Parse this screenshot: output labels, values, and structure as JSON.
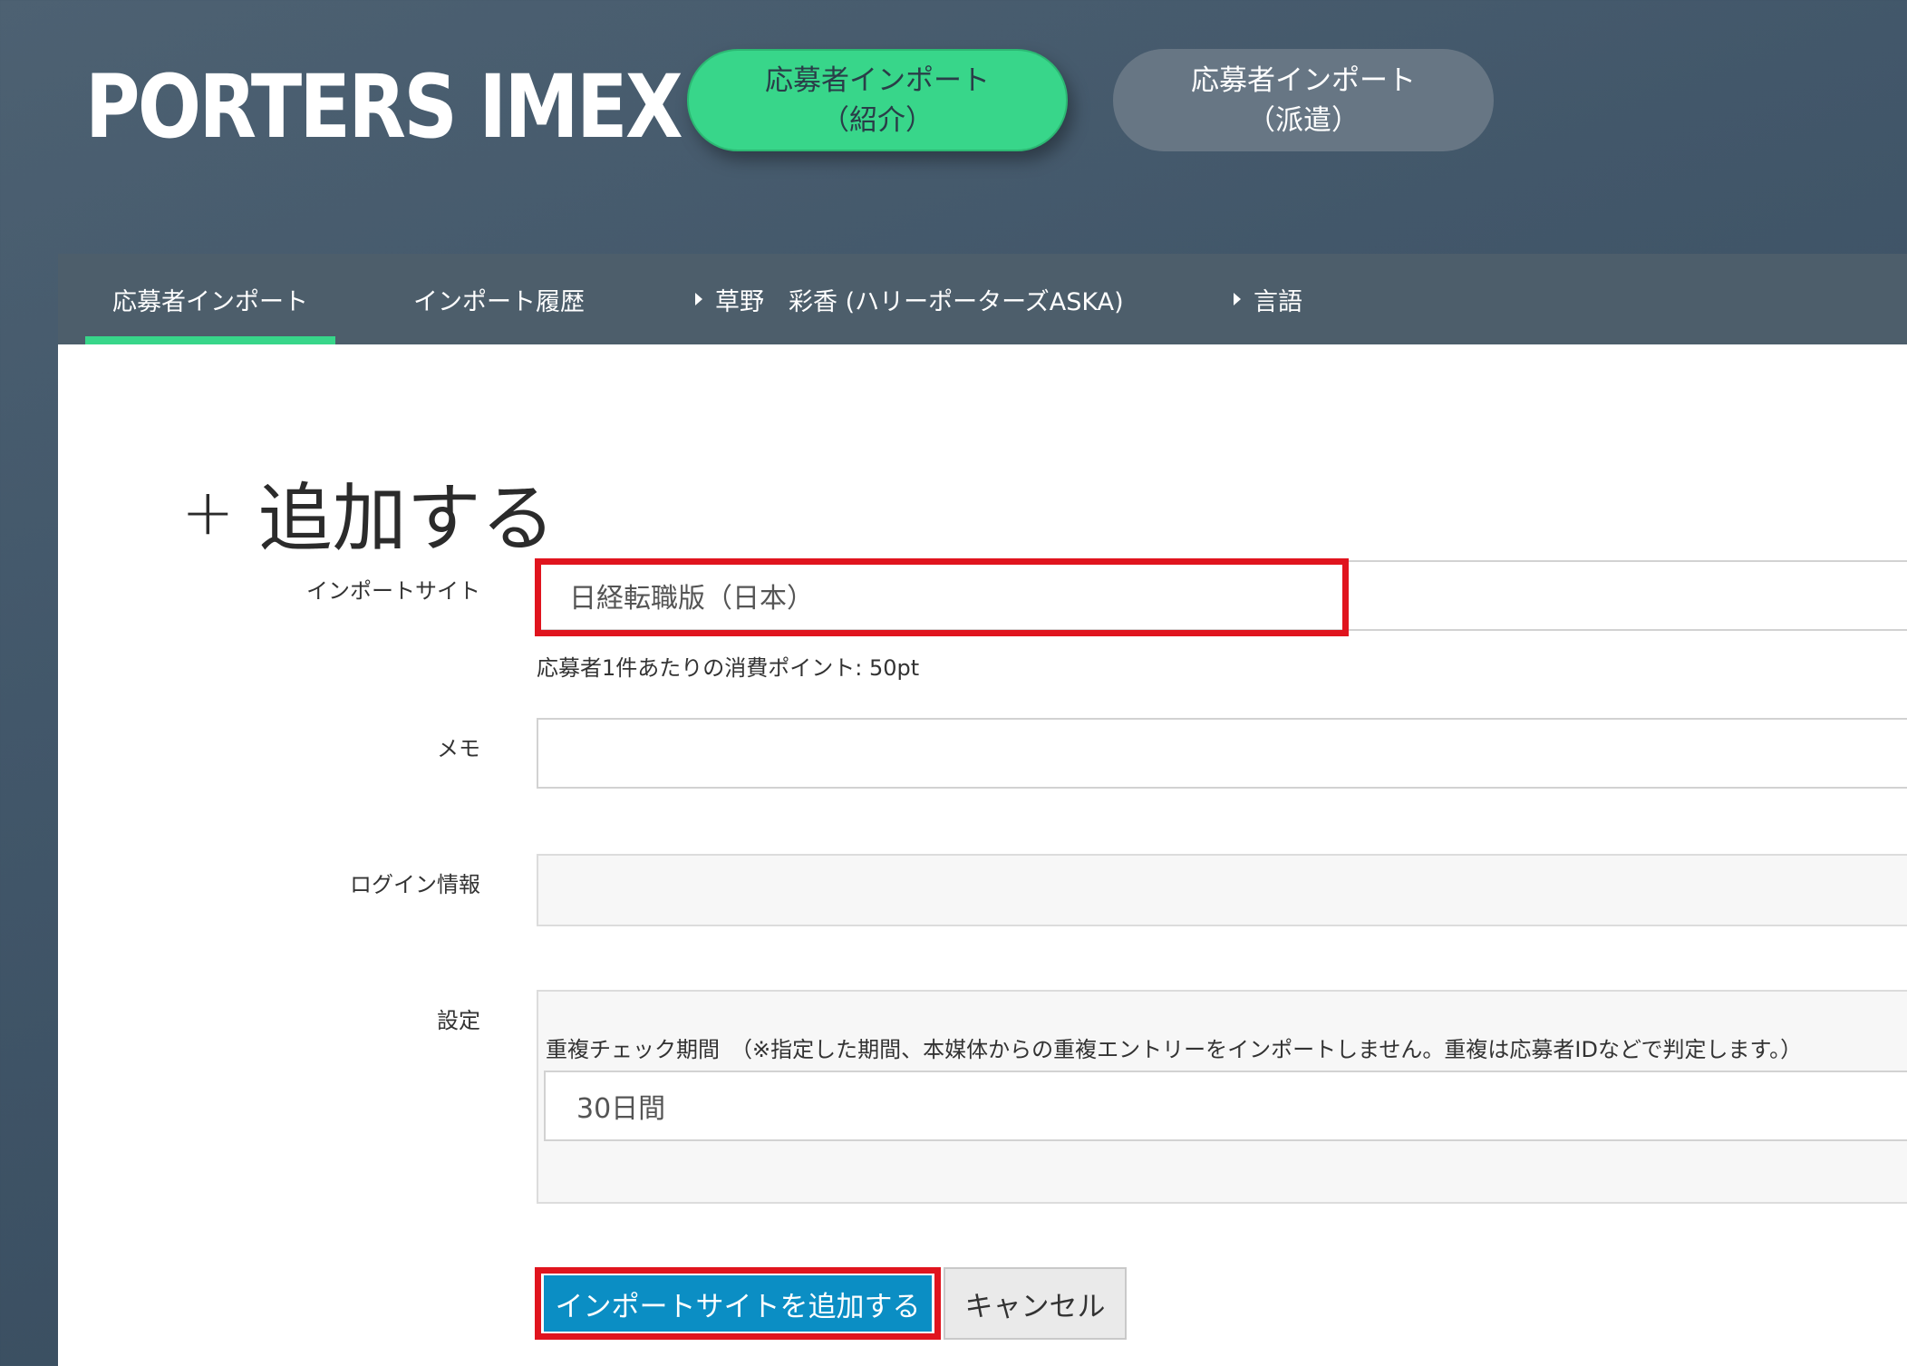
{
  "header": {
    "brand": "PORTERS IMEX",
    "buttons": [
      {
        "line1": "応募者インポート",
        "line2": "（紹介）"
      },
      {
        "line1": "応募者インポート",
        "line2": "（派遣）"
      }
    ]
  },
  "nav": {
    "items": [
      {
        "label": "応募者インポート"
      },
      {
        "label": "インポート履歴"
      },
      {
        "label": "草野　彩香 (ハリーポーターズASKA)"
      },
      {
        "label": "言語"
      }
    ]
  },
  "form": {
    "title": "追加する",
    "import_site": {
      "label": "インポートサイト",
      "value": "日経転職版（日本）",
      "points_note": "応募者1件あたりの消費ポイント: 50pt"
    },
    "memo": {
      "label": "メモ",
      "value": ""
    },
    "login_info": {
      "label": "ログイン情報",
      "value": ""
    },
    "settings": {
      "label": "設定",
      "duplicate_check_label": "重複チェック期間　（※指定した期間、本媒体からの重複エントリーをインポートしません。重複は応募者IDなどで判定します。）",
      "duplicate_check_value": "30日間"
    },
    "submit_label": "インポートサイトを追加する",
    "cancel_label": "キャンセル"
  },
  "colors": {
    "accent_green": "#38d68a",
    "primary_blue": "#0b8ec4",
    "highlight_red": "#e0141e",
    "nav_bg": "#4d5e6b"
  }
}
